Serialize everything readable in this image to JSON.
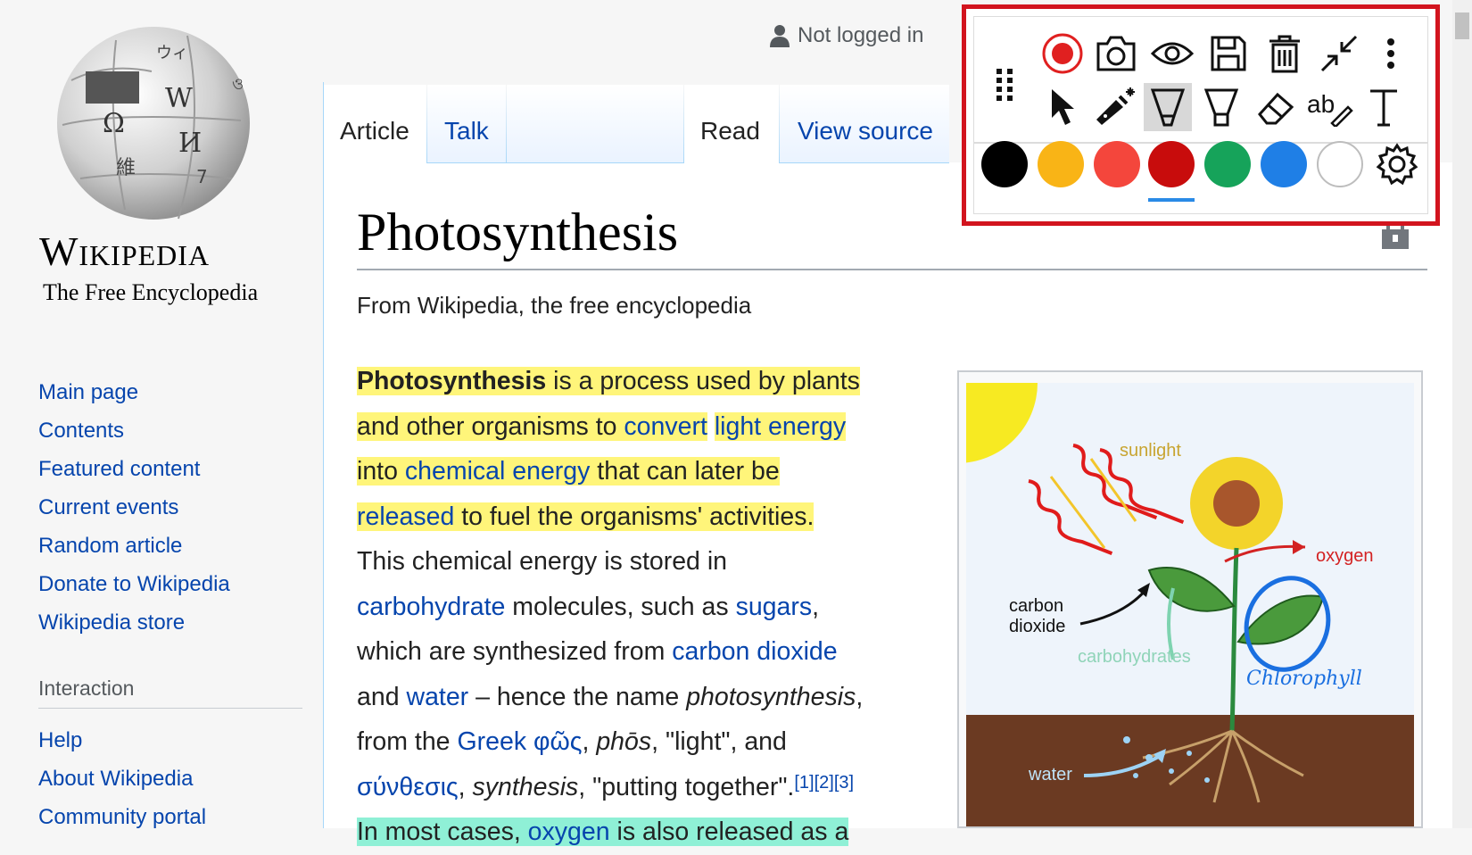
{
  "personal": {
    "label": "Not logged in"
  },
  "tabs": {
    "article": "Article",
    "talk": "Talk",
    "read": "Read",
    "view_source": "View source"
  },
  "logo": {
    "wordmark": "Wikipedia",
    "tagline": "The Free Encyclopedia"
  },
  "sidebar": {
    "main": [
      "Main page",
      "Contents",
      "Featured content",
      "Current events",
      "Random article",
      "Donate to Wikipedia",
      "Wikipedia store"
    ],
    "interaction_heading": "Interaction",
    "interaction": [
      "Help",
      "About Wikipedia",
      "Community portal"
    ]
  },
  "page": {
    "title": "Photosynthesis",
    "subtitle": "From Wikipedia, the free encyclopedia"
  },
  "article": {
    "l1a": "Photosynthesis",
    "l1b": " is a process used by plants",
    "l2a": "and other organisms to ",
    "l2b": "convert",
    "l2c": "light energy",
    "l3a": "into ",
    "l3b": "chemical energy",
    "l3c": " that can later be",
    "l4a": "released",
    "l4b": " to fuel the organisms' activities.",
    "l5": "This chemical energy is stored in",
    "l6a": "carbohydrate",
    "l6b": " molecules, such as ",
    "l6c": "sugars",
    "l6d": ",",
    "l7a": "which are synthesized from ",
    "l7b": "carbon dioxide",
    "l8a": "and ",
    "l8b": "water",
    "l8c": " – hence the name ",
    "l8d": "photosynthesis",
    "l8e": ",",
    "l9a": "from the ",
    "l9b": "Greek",
    "l9c": " ",
    "l9d": "φῶς",
    "l9e": ", ",
    "l9f": "phōs",
    "l9g": ", \"light\", and",
    "l10a": "σύνθεσις",
    "l10b": ", ",
    "l10c": "synthesis",
    "l10d": ", \"putting together\".",
    "ref1": "[1]",
    "ref2": "[2]",
    "ref3": "[3]",
    "l11a": "In most cases, ",
    "l11b": "oxygen",
    "l11c": " is also released as a"
  },
  "diagram": {
    "sunlight": "sunlight",
    "oxygen": "oxygen",
    "carbon_dioxide_1": "carbon",
    "carbon_dioxide_2": "dioxide",
    "carbohydrates": "carbohydrates",
    "chlorophyll": "Chlorophyll",
    "water": "water"
  },
  "toolbar": {
    "row1": [
      "drag-handle-icon",
      "record-icon",
      "camera-icon",
      "eye-icon",
      "save-icon",
      "trash-icon",
      "collapse-icon",
      "more-vert-icon"
    ],
    "row2": [
      "cursor-icon",
      "laser-pointer-icon",
      "highlighter-icon",
      "marker-icon",
      "eraser-icon",
      "text-replace-icon",
      "text-icon"
    ],
    "active_tool": "highlighter-icon",
    "colors": [
      "#000000",
      "#f9b416",
      "#f4463c",
      "#c80c0c",
      "#16a35a",
      "#1f7fe6",
      "#ffffff"
    ],
    "selected_color": "#c80c0c"
  }
}
